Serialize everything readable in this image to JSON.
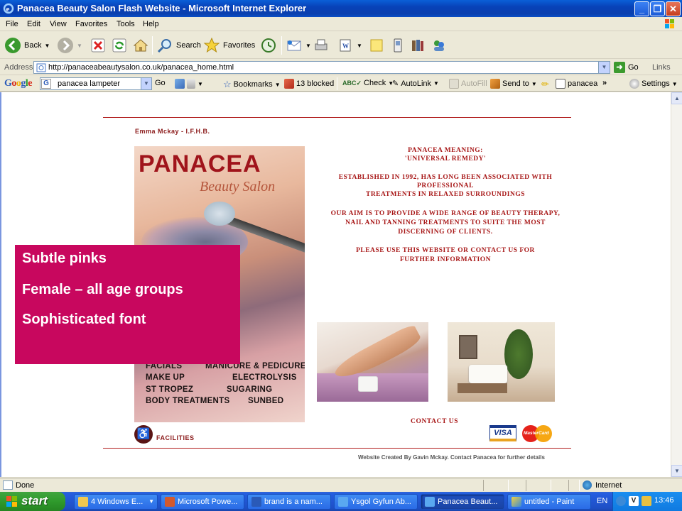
{
  "window": {
    "title": "Panacea Beauty Salon Flash Website - Microsoft Internet Explorer"
  },
  "menu": [
    "File",
    "Edit",
    "View",
    "Favorites",
    "Tools",
    "Help"
  ],
  "toolbar": {
    "back": "Back",
    "search": "Search",
    "favorites": "Favorites"
  },
  "address": {
    "label": "Address",
    "url": "http://panaceabeautysalon.co.uk/panacea_home.html",
    "go": "Go",
    "links": "Links"
  },
  "google_bar": {
    "logo": "Google",
    "query": "panacea lampeter",
    "go": "Go",
    "bookmarks": "Bookmarks",
    "blocked": "13 blocked",
    "check": "Check",
    "autolink": "AutoLink",
    "autofill": "AutoFill",
    "send_to": "Send to",
    "highlight_term": "panacea",
    "more": "»",
    "settings": "Settings"
  },
  "page": {
    "author": "Emma Mckay - I.F.H.B.",
    "poster_title": "PANACEA",
    "poster_subtitle": "Beauty Salon",
    "services": [
      "FACIALS",
      "MANICURE & PEDICURE",
      "MAKE UP",
      "ELECTROLYSIS",
      "ST TROPEZ",
      "SUGARING",
      "BODY TREATMENTS",
      "SUNBED"
    ],
    "meaning_1": "Panacea meaning:",
    "meaning_2": "'universal remedy'",
    "established_1": "Established in 1992, has long been associated with",
    "established_2": "professional",
    "established_3": "treatments in relaxed surroundings",
    "aim_1": "Our aim is to provide a wide range of beauty therapy,",
    "aim_2": "nail and tanning treatments to suite the most",
    "aim_3": "discerning of clients.",
    "please_1": "Please use this website or contact us for",
    "please_2": "further information",
    "contact": "CONTACT US",
    "facilities": "FACILITIES",
    "credit": "Website Created By Gavin Mckay. Contact Panacea for further details",
    "visa": "VISA",
    "mastercard": "MasterCard"
  },
  "overlay": {
    "points": [
      "Subtle pinks",
      "Female – all age  groups",
      "Sophisticated font"
    ],
    "color": "#c8075e"
  },
  "status": {
    "text": "Done",
    "zone": "Internet"
  },
  "taskbar": {
    "start": "start",
    "tasks": [
      {
        "label": "4 Windows E...",
        "icon": "folder-icon"
      },
      {
        "label": "Microsoft Powe...",
        "icon": "powerpoint-icon"
      },
      {
        "label": "brand is a nam...",
        "icon": "word-icon"
      },
      {
        "label": "Ysgol Gyfun Ab...",
        "icon": "ie-icon"
      },
      {
        "label": "Panacea Beaut...",
        "icon": "ie-icon"
      },
      {
        "label": "untitled - Paint",
        "icon": "paint-icon"
      }
    ],
    "language": "EN",
    "clock": "13:46"
  }
}
